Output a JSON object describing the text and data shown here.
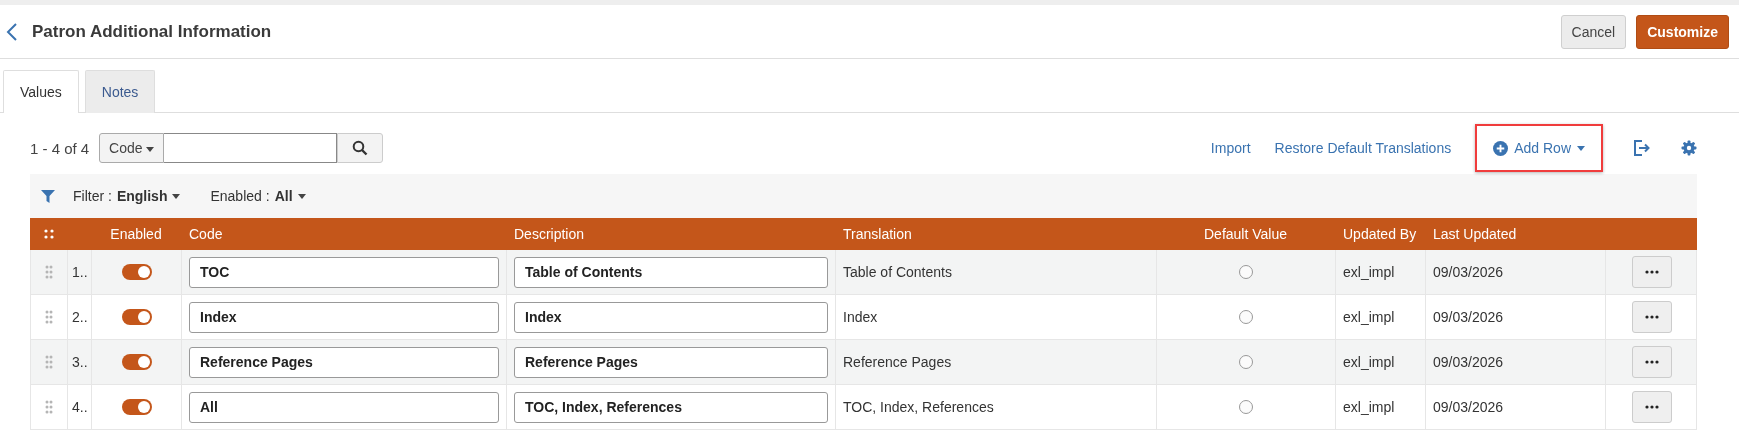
{
  "header": {
    "title": "Patron Additional Information",
    "buttons": [
      {
        "label": "Cancel",
        "kind": "secondary"
      },
      {
        "label": "Customize",
        "kind": "primary"
      }
    ]
  },
  "tabs": [
    {
      "label": "Values",
      "selected": true
    },
    {
      "label": "Notes",
      "selected": false
    }
  ],
  "toolbar": {
    "count": "1 - 4 of 4",
    "search_scope": "Code",
    "actions": [
      {
        "kind": "link",
        "label": "Import"
      },
      {
        "kind": "link",
        "label": "Restore Default Translations"
      },
      {
        "kind": "add",
        "label": "Add Row",
        "highlighted": true
      },
      {
        "kind": "export"
      },
      {
        "kind": "settings"
      }
    ]
  },
  "filters": [
    {
      "label": "Filter :",
      "value": "English"
    },
    {
      "label": "Enabled :",
      "value": "All"
    }
  ],
  "table": {
    "columns": [
      "Enabled",
      "Code",
      "Description",
      "Translation",
      "Default Value",
      "Updated By",
      "Last Updated"
    ],
    "rows": [
      {
        "number": "1..",
        "enabled": true,
        "code": "TOC",
        "description": "Table of Contents",
        "translation": "Table of Contents",
        "default": false,
        "updated_by": "exl_impl",
        "last_updated": "09/03/2026"
      },
      {
        "number": "2..",
        "enabled": true,
        "code": "Index",
        "description": "Index",
        "translation": "Index",
        "default": false,
        "updated_by": "exl_impl",
        "last_updated": "09/03/2026"
      },
      {
        "number": "3..",
        "enabled": true,
        "code": "Reference Pages",
        "description": "Reference Pages",
        "translation": "Reference Pages",
        "default": false,
        "updated_by": "exl_impl",
        "last_updated": "09/03/2026"
      },
      {
        "number": "4..",
        "enabled": true,
        "code": "All",
        "description": "TOC, Index, References",
        "translation": "TOC, Index, References",
        "default": false,
        "updated_by": "exl_impl",
        "last_updated": "09/03/2026"
      }
    ]
  }
}
